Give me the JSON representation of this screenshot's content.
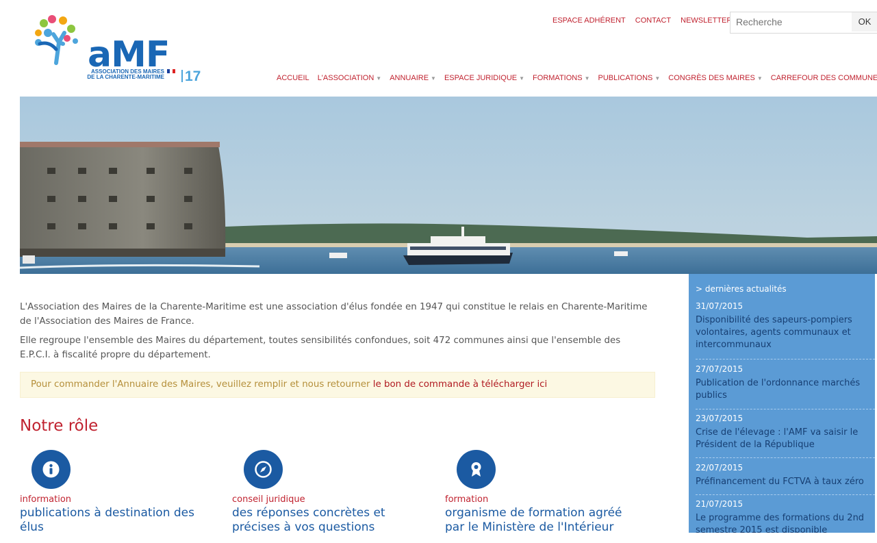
{
  "header": {
    "logo": {
      "brand": "aMF",
      "subtitle_line1": "ASSOCIATION DES MAIRES",
      "subtitle_line2": "DE LA CHARENTE-MARITIME",
      "number": "17"
    },
    "top_links": [
      "ESPACE ADHÉRENT",
      "CONTACT",
      "NEWSLETTER"
    ],
    "search": {
      "placeholder": "Recherche",
      "button": "OK"
    },
    "nav": [
      {
        "label": "ACCUEIL",
        "dropdown": false
      },
      {
        "label": "L'ASSOCIATION",
        "dropdown": true
      },
      {
        "label": "ANNUAIRE",
        "dropdown": true
      },
      {
        "label": "ESPACE JURIDIQUE",
        "dropdown": true
      },
      {
        "label": "FORMATIONS",
        "dropdown": true
      },
      {
        "label": "PUBLICATIONS",
        "dropdown": true
      },
      {
        "label": "CONGRÈS DES MAIRES",
        "dropdown": true
      },
      {
        "label": "CARREFOUR DES COMMUNES",
        "dropdown": true
      }
    ],
    "accent_color": "#c0222f"
  },
  "main": {
    "paragraph1": "L'Association des Maires de la Charente-Maritime est une association d'élus fondée en 1947 qui constitue le relais en Charente-Maritime de l'Association des Maires de France.",
    "paragraph2": "Elle regroupe l'ensemble des Maires du département, toutes sensibilités confondues, soit 472 communes ainsi que l'ensemble des E.P.C.I. à fiscalité propre du département.",
    "notice_text": "Pour commander l'Annuaire des Maires, veuillez remplir et nous retourner ",
    "notice_link": "le bon de commande à télécharger ici",
    "section_title": "Notre rôle",
    "roles": [
      {
        "icon": "info-icon",
        "category": "information",
        "description": "publications à destination des élus"
      },
      {
        "icon": "compass-icon",
        "category": "conseil juridique",
        "description": "des réponses concrètes et précises à vos questions"
      },
      {
        "icon": "award-icon",
        "category": "formation",
        "description": "organisme de formation agréé par le Ministère de l'Intérieur"
      }
    ]
  },
  "sidebar": {
    "heading": "> dernières actualités",
    "background": "#5b9bd5",
    "news": [
      {
        "date": "31/07/2015",
        "title": "Disponibilité des sapeurs-pompiers volontaires, agents communaux et intercommunaux"
      },
      {
        "date": "27/07/2015",
        "title": "Publication de l'ordonnance marchés publics"
      },
      {
        "date": "23/07/2015",
        "title": "Crise de l'élevage : l'AMF va saisir le Président de la République"
      },
      {
        "date": "22/07/2015",
        "title": "Préfinancement du FCTVA à taux zéro"
      },
      {
        "date": "21/07/2015",
        "title": "Le programme des formations du 2nd semestre 2015 est disponible"
      }
    ]
  }
}
